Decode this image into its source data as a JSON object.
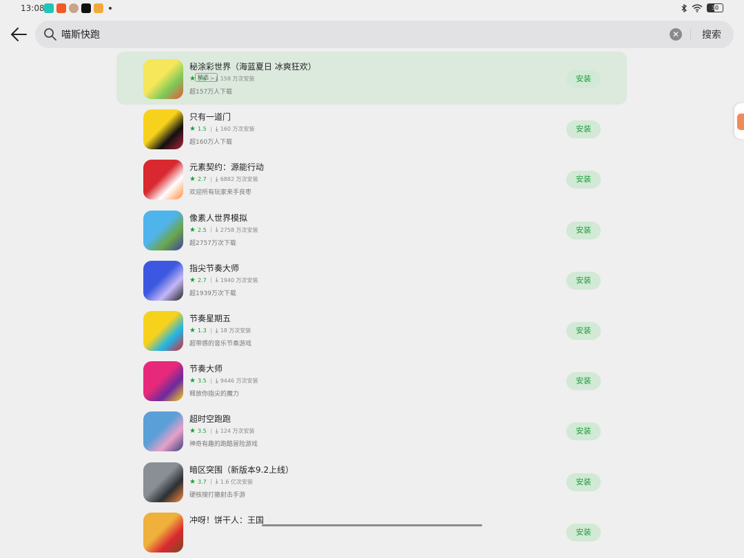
{
  "status_bar": {
    "time": "13:08",
    "notification_icons": [
      "taptap-icon",
      "game-app-icon",
      "avatar-app-icon",
      "tiktok-icon",
      "yellow-app-icon"
    ],
    "battery": "30",
    "battery_level": 0.3
  },
  "search": {
    "query": "喵斯快跑",
    "search_label": "搜索"
  },
  "apps": [
    {
      "name": "秘涂彩世界（海蓝夏日 冰爽狂欢）",
      "tag": "精选",
      "rating": "3.6",
      "installs": "158 万次安装",
      "desc": "超157万人下载",
      "install_label": "安装",
      "icon_colors": [
        "#f5e65a",
        "#7ec85a",
        "#e8553b"
      ]
    },
    {
      "name": "只有一道门",
      "tag": "",
      "rating": "1.5",
      "installs": "160 万次安装",
      "desc": "超160万人下载",
      "install_label": "安装",
      "icon_colors": [
        "#f7d21c",
        "#111111",
        "#b2233b"
      ]
    },
    {
      "name": "元素契约：源能行动",
      "tag": "",
      "rating": "2.7",
      "installs": "6882 万次安装",
      "desc": "欢迎所有玩家来手良枣",
      "install_label": "安装",
      "icon_colors": [
        "#d9282f",
        "#ffffff",
        "#ff8a3d"
      ]
    },
    {
      "name": "像素人世界模拟",
      "tag": "",
      "rating": "2.5",
      "installs": "2758 万次安装",
      "desc": "超2757万次下载",
      "install_label": "安装",
      "icon_colors": [
        "#4fb4ec",
        "#6ba547",
        "#3b3fa3"
      ]
    },
    {
      "name": "指尖节奏大师",
      "tag": "",
      "rating": "2.7",
      "installs": "1940 万次安装",
      "desc": "超1939万次下载",
      "install_label": "安装",
      "icon_colors": [
        "#3d58e0",
        "#c4b7f5",
        "#222222"
      ]
    },
    {
      "name": "节奏星期五",
      "tag": "",
      "rating": "1.3",
      "installs": "18 万次安装",
      "desc": "超带感的音乐节奏游戏",
      "install_label": "安装",
      "icon_colors": [
        "#f7d21c",
        "#1fb5e8",
        "#d9282f"
      ]
    },
    {
      "name": "节奏大师",
      "tag": "",
      "rating": "3.5",
      "installs": "9446 万次安装",
      "desc": "释放你指尖的魔力",
      "install_label": "安装",
      "icon_colors": [
        "#e8287a",
        "#6a2a9e",
        "#f7d21c"
      ]
    },
    {
      "name": "超时空跑跑",
      "tag": "",
      "rating": "3.5",
      "installs": "124 万次安装",
      "desc": "神奇有趣的跑酷冒险游戏",
      "install_label": "安装",
      "icon_colors": [
        "#5b9fd8",
        "#e8a0c8",
        "#3b3f7a"
      ]
    },
    {
      "name": "暗区突围（新版本9.2上线）",
      "tag": "",
      "rating": "3.7",
      "installs": "1.6 亿次安装",
      "desc": "硬核搜打撤射击手游",
      "install_label": "安装",
      "icon_colors": [
        "#8a8f96",
        "#2c2f33",
        "#ff8a3d"
      ]
    },
    {
      "name": "冲呀！饼干人：王国",
      "tag": "",
      "rating": "",
      "installs": "",
      "desc": "",
      "install_label": "安装",
      "icon_colors": [
        "#f0b03c",
        "#d9282f",
        "#7a4a1e"
      ]
    }
  ]
}
